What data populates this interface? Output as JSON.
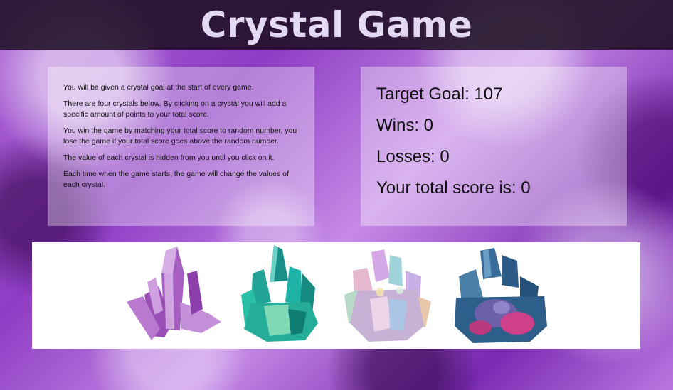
{
  "header": {
    "title": "Crystal Game"
  },
  "instructions": [
    "You will be given a crystal goal at the start of every game.",
    "There are four crystals below. By clicking on a crystal you will add a specific amount of points to your total score.",
    "You win the game by matching your total score to random number, you lose the game if your total score goes above the random number.",
    "The value of each crystal is hidden from you until you click on it.",
    "Each time when the game starts, the game will change the values of each crystal."
  ],
  "stats": {
    "target_label": "Target Goal: 107",
    "wins_label": "Wins: 0",
    "losses_label": "Losses: 0",
    "score_label": "Your total score is: 0"
  },
  "crystals": [
    {
      "icon": "purple-quartz-crystal-icon",
      "color": "#b06fc8"
    },
    {
      "icon": "teal-crystal-cluster-icon",
      "color": "#1fa89a"
    },
    {
      "icon": "rainbow-aura-crystal-icon",
      "color": "#c9a7d6"
    },
    {
      "icon": "blue-pink-geode-crystal-icon",
      "color": "#2e5f8a"
    }
  ]
}
